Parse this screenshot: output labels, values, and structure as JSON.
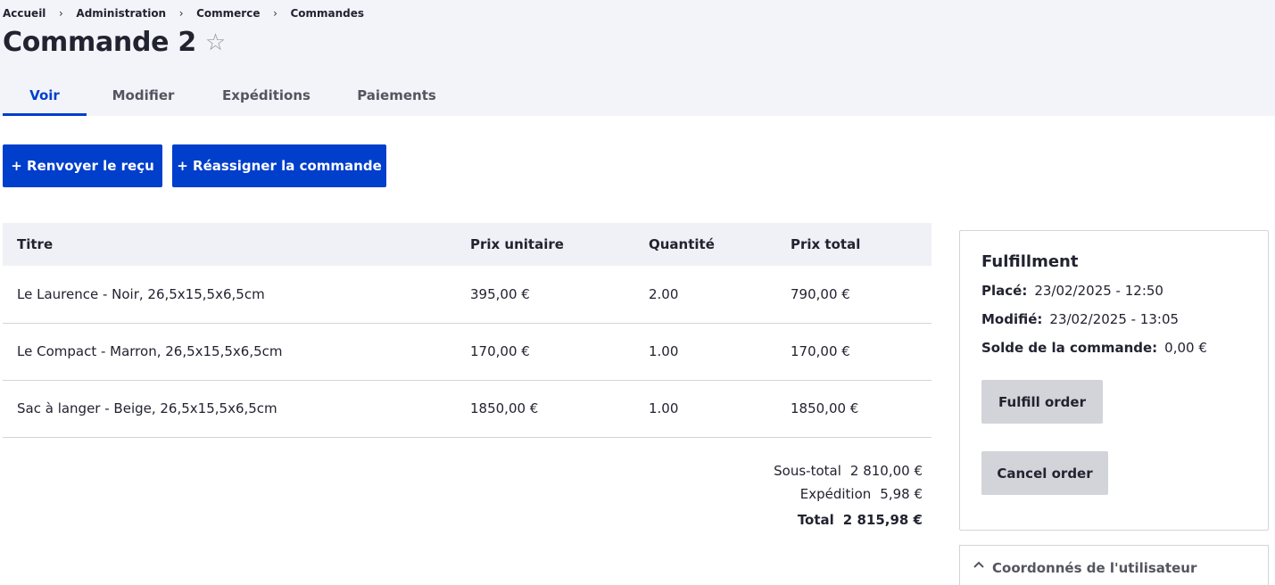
{
  "breadcrumb": [
    "Accueil",
    "Administration",
    "Commerce",
    "Commandes"
  ],
  "page": {
    "title": "Commande 2",
    "favorite_icon": "star-outline-icon"
  },
  "tabs": [
    "Voir",
    "Modifier",
    "Expéditions",
    "Paiements"
  ],
  "active_tab": "Voir",
  "actions": {
    "resend_receipt": "+ Renvoyer le reçu",
    "reassign_order": "+ Réassigner la commande"
  },
  "table": {
    "headers": [
      "Titre",
      "Prix unitaire",
      "Quantité",
      "Prix total"
    ],
    "rows": [
      [
        "Le Laurence - Noir, 26,5x15,5x6,5cm",
        "395,00 €",
        "2.00",
        "790,00 €"
      ],
      [
        "Le Compact - Marron, 26,5x15,5x6,5cm",
        "170,00 €",
        "1.00",
        "170,00 €"
      ],
      [
        "Sac à langer - Beige, 26,5x15,5x6,5cm",
        "1850,00 €",
        "1.00",
        "1850,00 €"
      ]
    ]
  },
  "totals": {
    "subtotal_label": "Sous-total",
    "subtotal_value": "2 810,00 €",
    "shipping_label": "Expédition",
    "shipping_value": "5,98 €",
    "total_label": "Total",
    "total_value": "2 815,98 €"
  },
  "fulfillment": {
    "title": "Fulfillment",
    "placed_label": "Placé:",
    "placed_value": "23/02/2025 - 12:50",
    "modified_label": "Modifié:",
    "modified_value": "23/02/2025 - 13:05",
    "balance_label": "Solde de la commande:",
    "balance_value": "0,00 €",
    "fulfill_button": "Fulfill order",
    "cancel_button": "Cancel order"
  },
  "user_section": {
    "label": "Coordonnés de l'utilisateur",
    "icon": "chevron-up-icon"
  },
  "colors": {
    "accent": "#003ecc",
    "header_bg": "#f3f4f9",
    "button_grey": "#d3d4d9"
  }
}
